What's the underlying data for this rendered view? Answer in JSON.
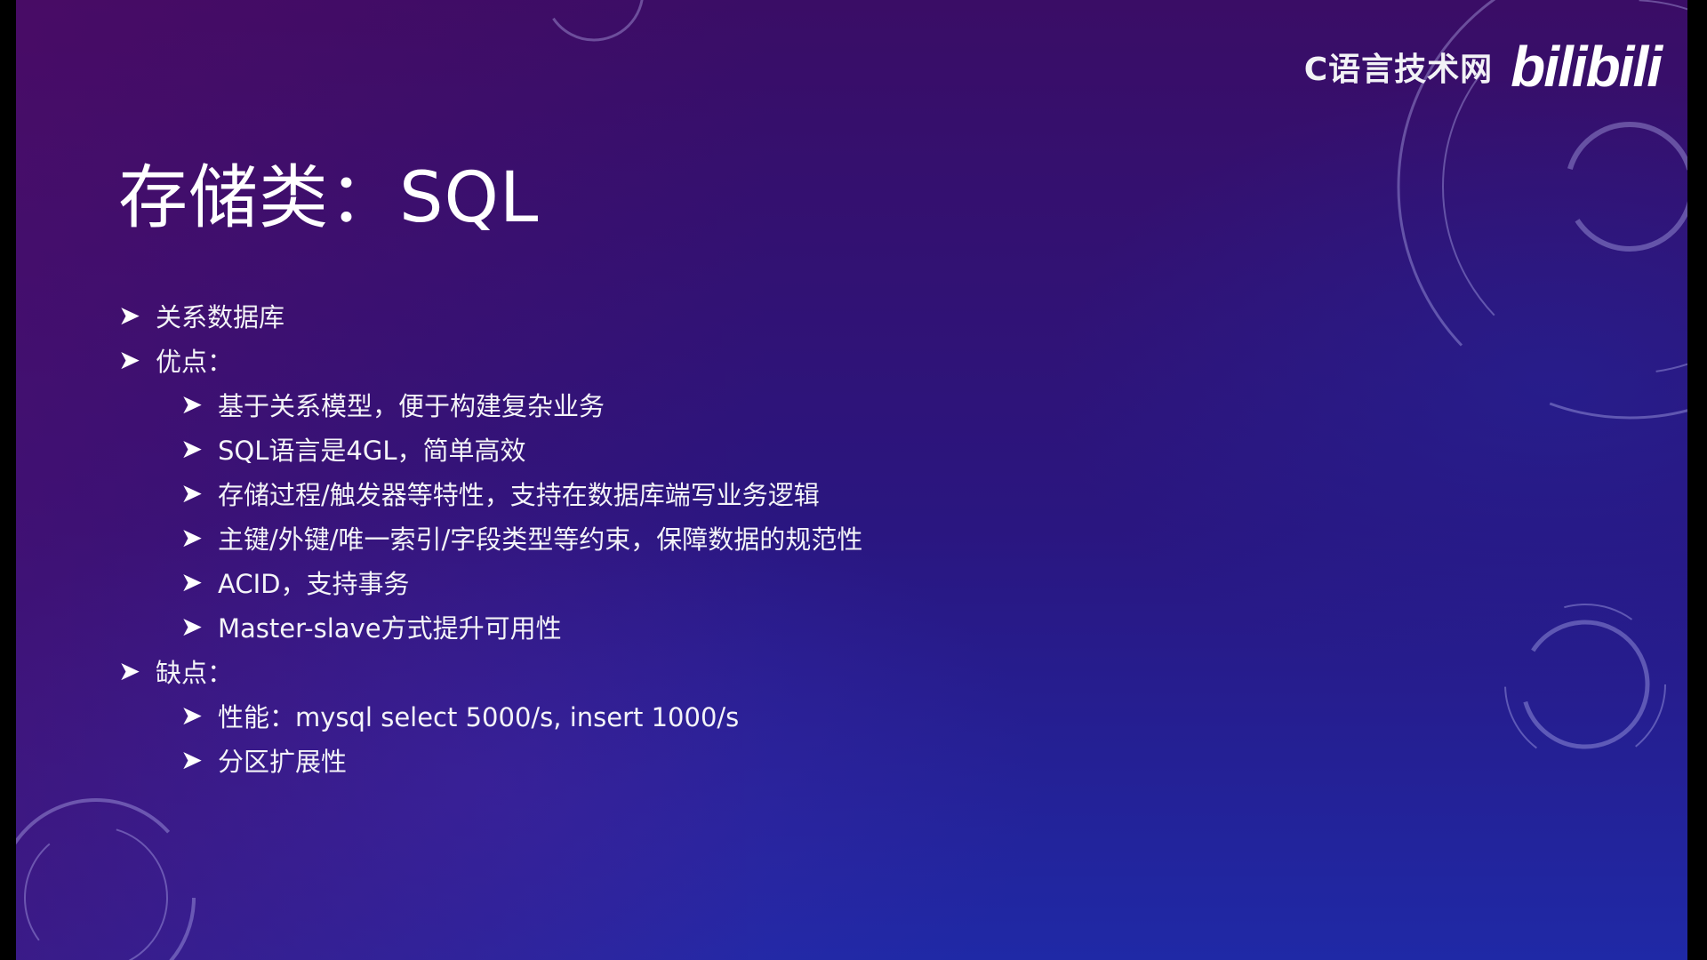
{
  "watermark": {
    "channel": "C语言技术网",
    "logo": "bilibili"
  },
  "slide": {
    "title": "存储类：SQL",
    "bullets": [
      {
        "level": 1,
        "text": "关系数据库"
      },
      {
        "level": 1,
        "text": "优点："
      },
      {
        "level": 2,
        "text": "基于关系模型，便于构建复杂业务"
      },
      {
        "level": 2,
        "text": "SQL语言是4GL，简单高效"
      },
      {
        "level": 2,
        "text": "存储过程/触发器等特性，支持在数据库端写业务逻辑"
      },
      {
        "level": 2,
        "text": "主键/外键/唯一索引/字段类型等约束，保障数据的规范性"
      },
      {
        "level": 2,
        "text": "ACID，支持事务"
      },
      {
        "level": 2,
        "text": "Master-slave方式提升可用性"
      },
      {
        "level": 1,
        "text": "缺点："
      },
      {
        "level": 2,
        "text": "性能：mysql select 5000/s, insert 1000/s"
      },
      {
        "level": 2,
        "text": "分区扩展性"
      }
    ]
  },
  "icons": {
    "bullet_marker": "arrow-right-icon"
  },
  "colors": {
    "text": "#ffffff",
    "bg_top": "#3a0d66",
    "bg_bottom": "#1f29a6"
  }
}
